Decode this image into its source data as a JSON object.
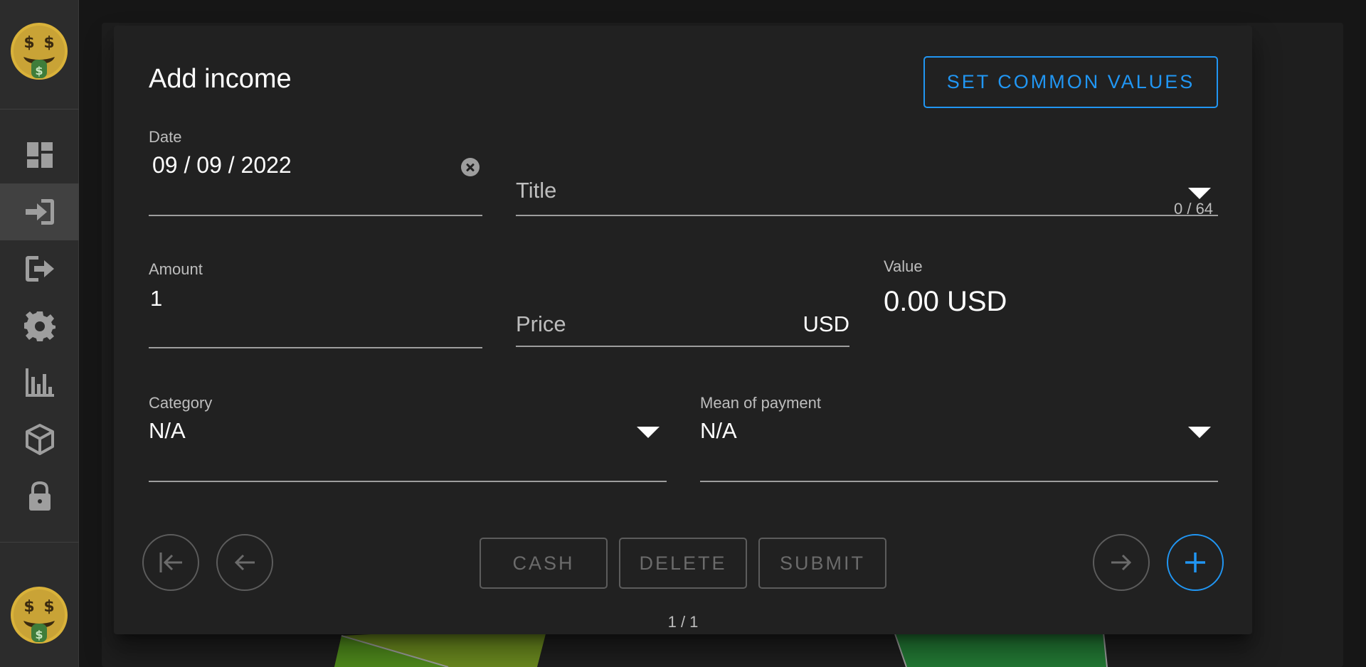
{
  "sidebar": {
    "logo_top": "money-mouth-face-icon",
    "logo_bottom": "money-mouth-face-icon",
    "items": [
      {
        "name": "dashboard-icon",
        "active": false
      },
      {
        "name": "income-login-icon",
        "active": true
      },
      {
        "name": "expense-logout-icon",
        "active": false
      },
      {
        "name": "settings-gear-icon",
        "active": false
      },
      {
        "name": "statistics-bar-chart-icon",
        "active": false
      },
      {
        "name": "package-box-icon",
        "active": false
      },
      {
        "name": "lock-icon",
        "active": false
      }
    ]
  },
  "dialog": {
    "title": "Add income",
    "common_values_label": "SET COMMON VALUES",
    "date": {
      "label": "Date",
      "value": "09 / 09 / 2022"
    },
    "title_field": {
      "placeholder": "Title",
      "counter": "0 / 64"
    },
    "amount": {
      "label": "Amount",
      "value": "1"
    },
    "price": {
      "placeholder": "Price",
      "suffix": "USD"
    },
    "value": {
      "label": "Value",
      "display": "0.00 USD"
    },
    "category": {
      "label": "Category",
      "value": "N/A"
    },
    "mean_of_payment": {
      "label": "Mean of payment",
      "value": "N/A"
    },
    "buttons": {
      "cash": "CASH",
      "delete": "DELETE",
      "submit": "SUBMIT"
    },
    "pager": "1 / 1"
  },
  "colors": {
    "accent": "#2196f3",
    "background": "#161616",
    "dialog_bg": "#212121",
    "sidebar_bg": "#2c2c2c",
    "disabled": "#6b6b6b"
  }
}
